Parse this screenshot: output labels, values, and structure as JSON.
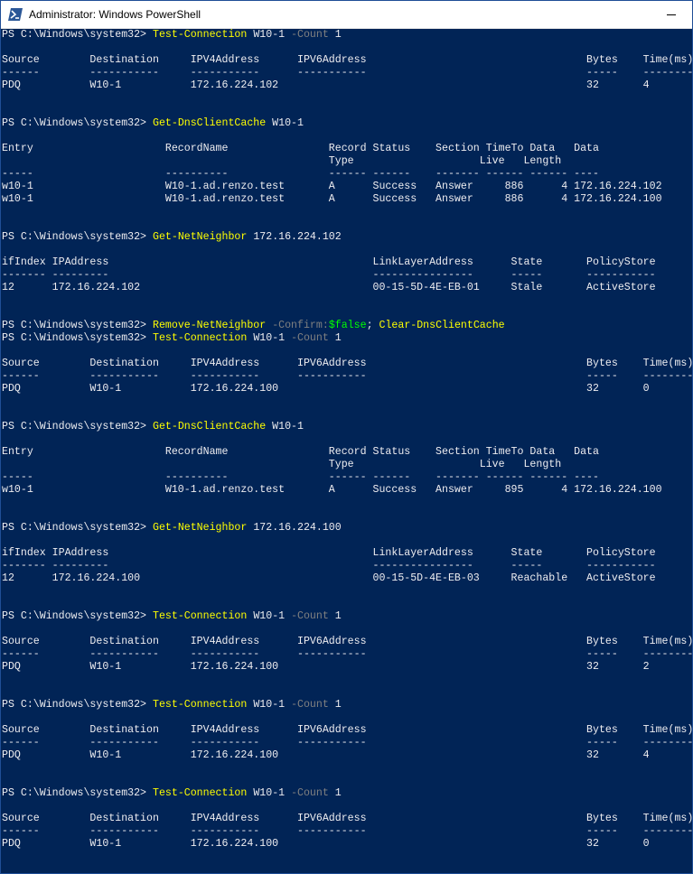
{
  "window": {
    "title": "Administrator: Windows PowerShell",
    "icon": "powershell-icon",
    "colors": {
      "console_bg": "#012456",
      "text": "#eeedf0",
      "command": "#ffff00",
      "parameter": "#808080",
      "variable": "#00ff00"
    }
  },
  "prompt": "PS C:\\Windows\\system32> ",
  "lines": [
    {
      "type": "cmd",
      "parts": [
        {
          "t": "Test-Connection",
          "c": "cmd"
        },
        {
          "t": " W10-1 ",
          "c": "str"
        },
        {
          "t": "-Count",
          "c": "param"
        },
        {
          "t": " 1",
          "c": "str"
        }
      ]
    },
    {
      "type": "text",
      "text": ""
    },
    {
      "type": "text",
      "text": "Source        Destination     IPV4Address      IPV6Address                                   Bytes    Time(ms)"
    },
    {
      "type": "text",
      "text": "------        -----------     -----------      -----------                                   -----    --------"
    },
    {
      "type": "text",
      "text": "PDQ           W10-1           172.16.224.102                                                 32       4"
    },
    {
      "type": "text",
      "text": ""
    },
    {
      "type": "text",
      "text": ""
    },
    {
      "type": "cmd",
      "parts": [
        {
          "t": "Get-DnsClientCache",
          "c": "cmd"
        },
        {
          "t": " W10-1",
          "c": "str"
        }
      ]
    },
    {
      "type": "text",
      "text": ""
    },
    {
      "type": "text",
      "text": "Entry                     RecordName                Record Status    Section TimeTo Data   Data"
    },
    {
      "type": "text",
      "text": "                                                    Type                    Live   Length"
    },
    {
      "type": "text",
      "text": "-----                     ----------                ------ ------    ------- ------ ------ ----"
    },
    {
      "type": "text",
      "text": "w10-1                     W10-1.ad.renzo.test       A      Success   Answer     886      4 172.16.224.102"
    },
    {
      "type": "text",
      "text": "w10-1                     W10-1.ad.renzo.test       A      Success   Answer     886      4 172.16.224.100"
    },
    {
      "type": "text",
      "text": ""
    },
    {
      "type": "text",
      "text": ""
    },
    {
      "type": "cmd",
      "parts": [
        {
          "t": "Get-NetNeighbor",
          "c": "cmd"
        },
        {
          "t": " 172.16.224.102",
          "c": "str"
        }
      ]
    },
    {
      "type": "text",
      "text": ""
    },
    {
      "type": "text",
      "text": "ifIndex IPAddress                                          LinkLayerAddress      State       PolicyStore"
    },
    {
      "type": "text",
      "text": "------- ---------                                          ----------------      -----       -----------"
    },
    {
      "type": "text",
      "text": "12      172.16.224.102                                     00-15-5D-4E-EB-01     Stale       ActiveStore"
    },
    {
      "type": "text",
      "text": ""
    },
    {
      "type": "text",
      "text": ""
    },
    {
      "type": "cmd",
      "parts": [
        {
          "t": "Remove-NetNeighbor",
          "c": "cmd"
        },
        {
          "t": " ",
          "c": "str"
        },
        {
          "t": "-Confirm:",
          "c": "param"
        },
        {
          "t": "$false",
          "c": "var"
        },
        {
          "t": "; ",
          "c": "str"
        },
        {
          "t": "Clear-DnsClientCache",
          "c": "cmd"
        }
      ]
    },
    {
      "type": "cmd",
      "parts": [
        {
          "t": "Test-Connection",
          "c": "cmd"
        },
        {
          "t": " W10-1 ",
          "c": "str"
        },
        {
          "t": "-Count",
          "c": "param"
        },
        {
          "t": " 1",
          "c": "str"
        }
      ]
    },
    {
      "type": "text",
      "text": ""
    },
    {
      "type": "text",
      "text": "Source        Destination     IPV4Address      IPV6Address                                   Bytes    Time(ms)"
    },
    {
      "type": "text",
      "text": "------        -----------     -----------      -----------                                   -----    --------"
    },
    {
      "type": "text",
      "text": "PDQ           W10-1           172.16.224.100                                                 32       0"
    },
    {
      "type": "text",
      "text": ""
    },
    {
      "type": "text",
      "text": ""
    },
    {
      "type": "cmd",
      "parts": [
        {
          "t": "Get-DnsClientCache",
          "c": "cmd"
        },
        {
          "t": " W10-1",
          "c": "str"
        }
      ]
    },
    {
      "type": "text",
      "text": ""
    },
    {
      "type": "text",
      "text": "Entry                     RecordName                Record Status    Section TimeTo Data   Data"
    },
    {
      "type": "text",
      "text": "                                                    Type                    Live   Length"
    },
    {
      "type": "text",
      "text": "-----                     ----------                ------ ------    ------- ------ ------ ----"
    },
    {
      "type": "text",
      "text": "w10-1                     W10-1.ad.renzo.test       A      Success   Answer     895      4 172.16.224.100"
    },
    {
      "type": "text",
      "text": ""
    },
    {
      "type": "text",
      "text": ""
    },
    {
      "type": "cmd",
      "parts": [
        {
          "t": "Get-NetNeighbor",
          "c": "cmd"
        },
        {
          "t": " 172.16.224.100",
          "c": "str"
        }
      ]
    },
    {
      "type": "text",
      "text": ""
    },
    {
      "type": "text",
      "text": "ifIndex IPAddress                                          LinkLayerAddress      State       PolicyStore"
    },
    {
      "type": "text",
      "text": "------- ---------                                          ----------------      -----       -----------"
    },
    {
      "type": "text",
      "text": "12      172.16.224.100                                     00-15-5D-4E-EB-03     Reachable   ActiveStore"
    },
    {
      "type": "text",
      "text": ""
    },
    {
      "type": "text",
      "text": ""
    },
    {
      "type": "cmd",
      "parts": [
        {
          "t": "Test-Connection",
          "c": "cmd"
        },
        {
          "t": " W10-1 ",
          "c": "str"
        },
        {
          "t": "-Count",
          "c": "param"
        },
        {
          "t": " 1",
          "c": "str"
        }
      ]
    },
    {
      "type": "text",
      "text": ""
    },
    {
      "type": "text",
      "text": "Source        Destination     IPV4Address      IPV6Address                                   Bytes    Time(ms)"
    },
    {
      "type": "text",
      "text": "------        -----------     -----------      -----------                                   -----    --------"
    },
    {
      "type": "text",
      "text": "PDQ           W10-1           172.16.224.100                                                 32       2"
    },
    {
      "type": "text",
      "text": ""
    },
    {
      "type": "text",
      "text": ""
    },
    {
      "type": "cmd",
      "parts": [
        {
          "t": "Test-Connection",
          "c": "cmd"
        },
        {
          "t": " W10-1 ",
          "c": "str"
        },
        {
          "t": "-Count",
          "c": "param"
        },
        {
          "t": " 1",
          "c": "str"
        }
      ]
    },
    {
      "type": "text",
      "text": ""
    },
    {
      "type": "text",
      "text": "Source        Destination     IPV4Address      IPV6Address                                   Bytes    Time(ms)"
    },
    {
      "type": "text",
      "text": "------        -----------     -----------      -----------                                   -----    --------"
    },
    {
      "type": "text",
      "text": "PDQ           W10-1           172.16.224.100                                                 32       4"
    },
    {
      "type": "text",
      "text": ""
    },
    {
      "type": "text",
      "text": ""
    },
    {
      "type": "cmd",
      "parts": [
        {
          "t": "Test-Connection",
          "c": "cmd"
        },
        {
          "t": " W10-1 ",
          "c": "str"
        },
        {
          "t": "-Count",
          "c": "param"
        },
        {
          "t": " 1",
          "c": "str"
        }
      ]
    },
    {
      "type": "text",
      "text": ""
    },
    {
      "type": "text",
      "text": "Source        Destination     IPV4Address      IPV6Address                                   Bytes    Time(ms)"
    },
    {
      "type": "text",
      "text": "------        -----------     -----------      -----------                                   -----    --------"
    },
    {
      "type": "text",
      "text": "PDQ           W10-1           172.16.224.100                                                 32       0"
    }
  ]
}
